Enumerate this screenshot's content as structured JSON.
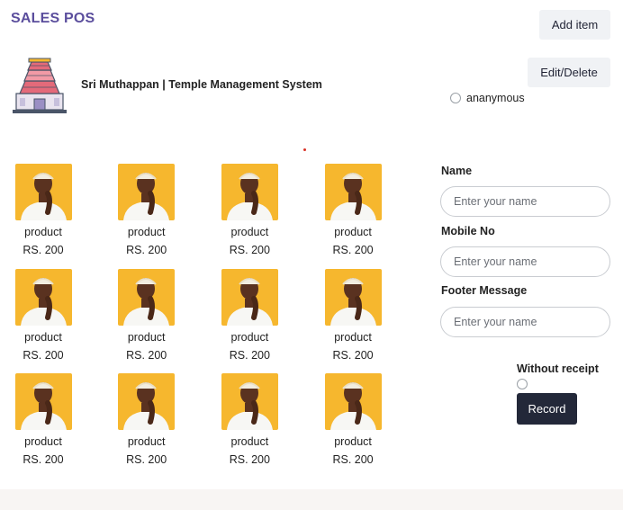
{
  "header": {
    "title": "SALES POS",
    "add_item_label": "Add item",
    "edit_delete_label": "Edit/Delete"
  },
  "org": {
    "name": "Sri Muthappan | Temple Management System",
    "logo_icon": "temple-gopuram-icon"
  },
  "anonymous": {
    "label": "ananymous",
    "checked": false
  },
  "products": [
    {
      "name": "product",
      "price": "RS. 200"
    },
    {
      "name": "product",
      "price": "RS. 200"
    },
    {
      "name": "product",
      "price": "RS. 200"
    },
    {
      "name": "product",
      "price": "RS. 200"
    },
    {
      "name": "product",
      "price": "RS. 200"
    },
    {
      "name": "product",
      "price": "RS. 200"
    },
    {
      "name": "product",
      "price": "RS. 200"
    },
    {
      "name": "product",
      "price": "RS. 200"
    },
    {
      "name": "product",
      "price": "RS. 200"
    },
    {
      "name": "product",
      "price": "RS. 200"
    },
    {
      "name": "product",
      "price": "RS. 200"
    },
    {
      "name": "product",
      "price": "RS. 200"
    }
  ],
  "form": {
    "name_label": "Name",
    "name_placeholder": "Enter your name",
    "name_value": "",
    "mobile_label": "Mobile No",
    "mobile_placeholder": "Enter your name",
    "mobile_value": "",
    "footer_label": "Footer Message",
    "footer_placeholder": "Enter your name",
    "footer_value": "",
    "without_receipt_label": "Without receipt",
    "without_receipt_checked": false,
    "record_label": "Record"
  },
  "colors": {
    "title": "#5b4e9d",
    "record_button": "#232839",
    "product_bg": "#f6b72e"
  }
}
